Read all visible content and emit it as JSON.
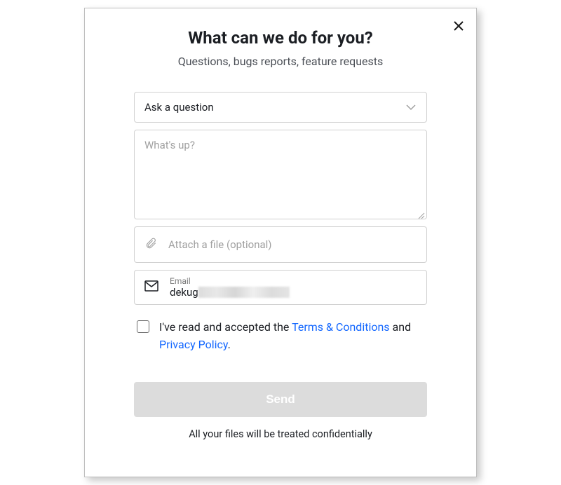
{
  "header": {
    "title": "What can we do for you?",
    "subtitle": "Questions, bugs reports, feature requests"
  },
  "form": {
    "category_selected": "Ask a question",
    "message_placeholder": "What's up?",
    "attach_label": "Attach a file (optional)",
    "email_label": "Email",
    "email_value_visible": "dekug"
  },
  "consent": {
    "prefix": "I've read and accepted the ",
    "terms_label": "Terms & Conditions",
    "middle": " and ",
    "privacy_label": "Privacy Policy",
    "suffix": "."
  },
  "actions": {
    "send_label": "Send"
  },
  "footer": {
    "note": "All your files will be treated confidentially"
  }
}
